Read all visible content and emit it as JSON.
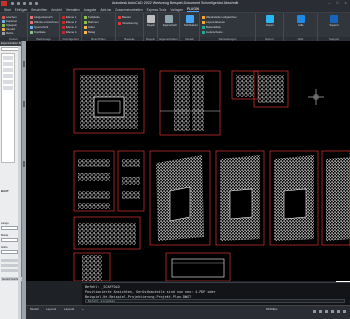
{
  "window": {
    "title": "Autodesk AutoCAD 2022  Werkzeug Beispiel-Dokument  Schnellgerüst Abschnitt"
  },
  "tabs": [
    "Start",
    "Einfügen",
    "Beschriften",
    "Ansicht",
    "Verwalten",
    "Ausgabe",
    "Add-ins",
    "Zusammenarbeiten",
    "Express Tools",
    "Vorlagen",
    "PLUGIN"
  ],
  "active_tab": "PLUGIN",
  "ribbon": {
    "panels": [
      {
        "caption": "Ändern",
        "items": [
          "Löschen",
          "Kopieren",
          "Spiegeln",
          "Versatz",
          "Reihe",
          "Drehen"
        ]
      },
      {
        "caption": "Werkzeuge",
        "items": [
          "Längenbereich",
          "Wände einzeichnen",
          "Querschnitt",
          "Duplikate"
        ]
      },
      {
        "caption": "Grundgerüst",
        "items": [
          "Ebene 1",
          "Ebene 2",
          "Ebene 3",
          "Ebene 4"
        ]
      },
      {
        "caption": "Beschriften",
        "items": [
          "Fußplatte",
          "Rahmen",
          "Gitter",
          "Belag"
        ]
      },
      {
        "caption": "Bauteile",
        "items": [
          "Bauteil",
          "Verankerung"
        ]
      },
      {
        "caption": "Regeln",
        "items": [
          "Regeln"
        ]
      },
      {
        "caption": "Eigenschaften",
        "items": [
          "Eigenschaft"
        ]
      },
      {
        "caption": "Modell",
        "items": [
          "Sichtbarkeit"
        ]
      },
      {
        "caption": "Darstellungen",
        "items": [
          "Wandstärken abgleichen",
          "Layout-Ebenen",
          "Materialliste",
          "Lieferscheine"
        ]
      },
      {
        "caption": "Export",
        "items": [
          "Export"
        ]
      },
      {
        "caption": "Hilfe",
        "items": [
          "Hilfe"
        ]
      },
      {
        "caption": "Support",
        "items": [
          "Support"
        ]
      }
    ]
  },
  "left_palette": {
    "header": "Eigenschaften Beispiel-Nr.",
    "section_label": "BAUT",
    "label_1": "Länge",
    "label_2": "Breite",
    "label_3": "Höhe",
    "button_label": "Gerüst Suchen"
  },
  "command_line": {
    "line1": "Befehl: _SCAFFOLD",
    "line2": "Positionierte Ansichten, Gerüstbauteile sind nun neu: 4.PDF oder",
    "line3": "Beispiel-Nr.Beispiel.Projektierung.Projekt.Plan.DWG?",
    "prompt": "Befehl eingeben"
  },
  "status_bar": {
    "tabs": [
      "Modell",
      "Layout1",
      "Layout2",
      "+"
    ],
    "right_text": "MODELL"
  },
  "colors": {
    "accent": "#4aa3ff",
    "frame_red": "#ff3b3b",
    "drawing_white": "#ffffff"
  }
}
